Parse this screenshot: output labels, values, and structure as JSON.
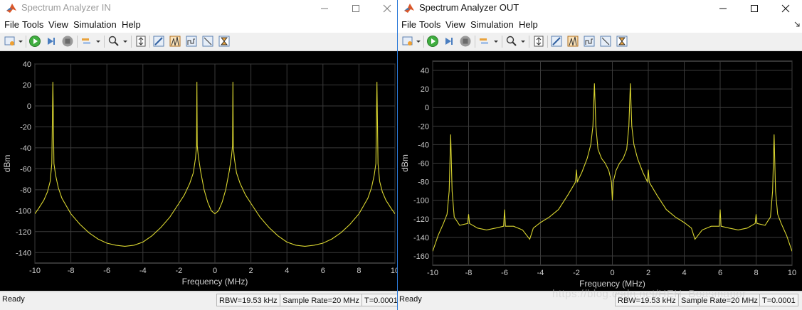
{
  "windows": [
    {
      "id": "in",
      "title": "Spectrum Analyzer IN",
      "menu": [
        "File",
        "Tools",
        "View",
        "Simulation",
        "Help"
      ],
      "status": {
        "ready": "Ready",
        "rbw": "RBW=19.53 kHz",
        "sample_rate": "Sample Rate=20 MHz",
        "time": "T=0.0001"
      }
    },
    {
      "id": "out",
      "title": "Spectrum Analyzer OUT",
      "menu": [
        "File",
        "Tools",
        "View",
        "Simulation",
        "Help"
      ],
      "status": {
        "ready": "Ready",
        "rbw": "RBW=19.53 kHz",
        "sample_rate": "Sample Rate=20 MHz",
        "time": "T=0.0001"
      }
    }
  ],
  "colors": {
    "trace": "#d9d530",
    "plot_bg": "#000000",
    "grid": "#3a3a3a",
    "tick_text": "#cfcfcf",
    "titlebar_text_inactive": "#9a9a9a"
  },
  "icons": [
    "matlab-logo-icon",
    "minimize-icon",
    "maximize-icon",
    "close-icon",
    "settings-icon",
    "run-icon",
    "step-forward-icon",
    "stop-icon",
    "highlight-icon",
    "zoom-icon",
    "scale-axes-icon",
    "measurement-icons"
  ],
  "watermark": "https://blog.csdn.net/HEH_Boasmanor",
  "chart_data": [
    {
      "type": "line",
      "title": "",
      "xlabel": "Frequency (MHz)",
      "ylabel": "dBm",
      "xlim": [
        -10,
        10
      ],
      "ylim": [
        -150,
        40
      ],
      "xticks": [
        -10,
        -8,
        -6,
        -4,
        -2,
        0,
        2,
        4,
        6,
        8,
        10
      ],
      "yticks": [
        40,
        20,
        0,
        -20,
        -40,
        -60,
        -80,
        -100,
        -120,
        -140
      ],
      "grid": true,
      "series": [
        {
          "name": "",
          "x": [
            -10,
            -9.8,
            -9.5,
            -9.3,
            -9.15,
            -9.06,
            -9,
            -8.94,
            -8.85,
            -8.7,
            -8.5,
            -8.2,
            -8,
            -7.5,
            -7,
            -6.5,
            -6,
            -5.5,
            -5,
            -4.5,
            -4,
            -3.5,
            -3,
            -2.5,
            -2,
            -1.7,
            -1.4,
            -1.2,
            -1.08,
            -1.02,
            -1,
            -0.98,
            -0.92,
            -0.8,
            -0.6,
            -0.4,
            -0.2,
            0,
            0.2,
            0.4,
            0.6,
            0.8,
            0.92,
            0.98,
            1,
            1.02,
            1.08,
            1.2,
            1.4,
            1.7,
            2,
            2.5,
            3,
            3.5,
            4,
            4.5,
            5,
            5.5,
            6,
            6.5,
            7,
            7.5,
            8,
            8.2,
            8.5,
            8.7,
            8.85,
            8.94,
            9,
            9.06,
            9.15,
            9.3,
            9.5,
            9.8,
            10
          ],
          "y": [
            -103,
            -98,
            -90,
            -82,
            -72,
            -55,
            23,
            -55,
            -66,
            -78,
            -88,
            -97,
            -103,
            -113,
            -121,
            -127,
            -131,
            -133,
            -134,
            -133,
            -130,
            -124,
            -116,
            -106,
            -93,
            -85,
            -74,
            -64,
            -50,
            -38,
            23,
            -38,
            -48,
            -62,
            -80,
            -92,
            -100,
            -103,
            -100,
            -92,
            -80,
            -62,
            -48,
            -38,
            23,
            -38,
            -50,
            -64,
            -74,
            -85,
            -93,
            -106,
            -116,
            -124,
            -130,
            -133,
            -134,
            -133,
            -131,
            -127,
            -121,
            -113,
            -103,
            -97,
            -88,
            -78,
            -66,
            -55,
            23,
            -55,
            -72,
            -82,
            -90,
            -98,
            -103
          ]
        }
      ]
    },
    {
      "type": "line",
      "title": "",
      "xlabel": "Frequency (MHz)",
      "ylabel": "dBm",
      "xlim": [
        -10,
        10
      ],
      "ylim": [
        -170,
        50
      ],
      "xticks": [
        -10,
        -8,
        -6,
        -4,
        -2,
        0,
        2,
        4,
        6,
        8,
        10
      ],
      "yticks": [
        40,
        20,
        0,
        -20,
        -40,
        -60,
        -80,
        -100,
        -120,
        -140,
        -160
      ],
      "grid": true,
      "series": [
        {
          "name": "",
          "x": [
            -10,
            -9.7,
            -9.4,
            -9.2,
            -9.08,
            -9,
            -8.92,
            -8.8,
            -8.5,
            -8.05,
            -8,
            -7.95,
            -7.5,
            -7,
            -6.5,
            -6.05,
            -6,
            -5.95,
            -5.5,
            -5,
            -4.6,
            -4.4,
            -4,
            -3.5,
            -3,
            -2.5,
            -2.1,
            -2.05,
            -2,
            -1.95,
            -1.7,
            -1.4,
            -1.2,
            -1.08,
            -1,
            -0.92,
            -0.8,
            -0.6,
            -0.4,
            -0.2,
            -0.05,
            0,
            0.05,
            0.2,
            0.4,
            0.6,
            0.8,
            0.92,
            1,
            1.08,
            1.2,
            1.4,
            1.7,
            1.95,
            2,
            2.05,
            2.1,
            2.5,
            3,
            3.5,
            4,
            4.4,
            4.6,
            5,
            5.5,
            5.95,
            6,
            6.05,
            6.5,
            7,
            7.5,
            7.95,
            8,
            8.05,
            8.5,
            8.8,
            8.92,
            9,
            9.08,
            9.2,
            9.4,
            9.7,
            10
          ],
          "y": [
            -155,
            -138,
            -125,
            -115,
            -90,
            -29,
            -90,
            -118,
            -127,
            -125,
            -115,
            -125,
            -130,
            -132,
            -130,
            -128,
            -110,
            -128,
            -128,
            -132,
            -142,
            -130,
            -124,
            -118,
            -110,
            -95,
            -82,
            -80,
            -67,
            -80,
            -70,
            -55,
            -40,
            -20,
            26,
            -20,
            -45,
            -55,
            -60,
            -68,
            -80,
            -100,
            -80,
            -68,
            -60,
            -55,
            -45,
            -20,
            26,
            -20,
            -40,
            -55,
            -70,
            -80,
            -67,
            -80,
            -82,
            -95,
            -110,
            -118,
            -124,
            -130,
            -142,
            -132,
            -128,
            -128,
            -110,
            -128,
            -130,
            -132,
            -130,
            -125,
            -115,
            -125,
            -127,
            -118,
            -90,
            -29,
            -90,
            -115,
            -125,
            -138,
            -155
          ]
        }
      ]
    }
  ]
}
